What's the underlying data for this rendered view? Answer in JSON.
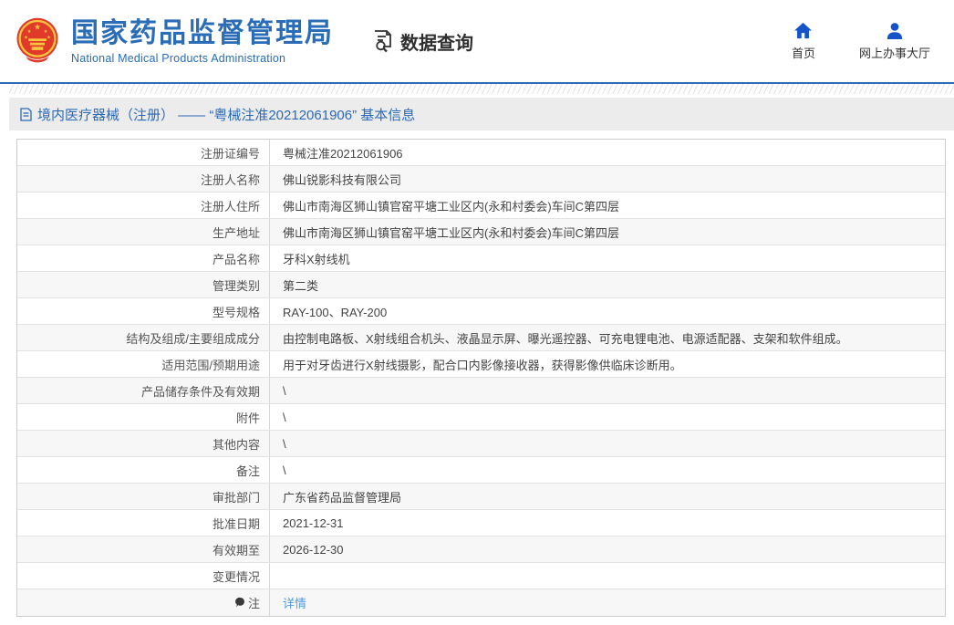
{
  "header": {
    "org_name_cn": "国家药品监督管理局",
    "org_name_en": "National Medical Products Administration",
    "section_label": "数据查询",
    "nav": [
      {
        "icon": "home-icon",
        "label": "首页"
      },
      {
        "icon": "user-icon",
        "label": "网上办事大厅"
      }
    ]
  },
  "breadcrumb": {
    "text": "境内医疗器械（注册） —— “粤械注准20212061906” 基本信息"
  },
  "table": {
    "rows": [
      {
        "label": "注册证编号",
        "value": "粤械注准20212061906"
      },
      {
        "label": "注册人名称",
        "value": "佛山锐影科技有限公司"
      },
      {
        "label": "注册人住所",
        "value": "佛山市南海区狮山镇官窑平塘工业区内(永和村委会)车间C第四层"
      },
      {
        "label": "生产地址",
        "value": "佛山市南海区狮山镇官窑平塘工业区内(永和村委会)车间C第四层"
      },
      {
        "label": "产品名称",
        "value": "牙科X射线机"
      },
      {
        "label": "管理类别",
        "value": "第二类"
      },
      {
        "label": "型号规格",
        "value": "RAY-100、RAY-200"
      },
      {
        "label": "结构及组成/主要组成成分",
        "value": "由控制电路板、X射线组合机头、液晶显示屏、曝光遥控器、可充电锂电池、电源适配器、支架和软件组成。"
      },
      {
        "label": "适用范围/预期用途",
        "value": "用于对牙齿进行X射线摄影，配合口内影像接收器，获得影像供临床诊断用。"
      },
      {
        "label": "产品储存条件及有效期",
        "value": "\\"
      },
      {
        "label": "附件",
        "value": "\\"
      },
      {
        "label": "其他内容",
        "value": "\\"
      },
      {
        "label": "备注",
        "value": "\\"
      },
      {
        "label": "审批部门",
        "value": "广东省药品监督管理局"
      },
      {
        "label": "批准日期",
        "value": "2021-12-31"
      },
      {
        "label": "有效期至",
        "value": "2026-12-30"
      },
      {
        "label": "变更情况",
        "value": ""
      },
      {
        "label": "注",
        "value": "详情",
        "label_icon": "note-bulb-icon",
        "is_link": true
      }
    ]
  },
  "colors": {
    "brand_blue": "#2a6cb6",
    "nav_icon_blue": "#1553c8",
    "divider_blue": "#2b6cb5",
    "breadcrumb_bg": "#ececec",
    "row_alt_bg": "#f7f7f7",
    "link_blue": "#4f9be5"
  }
}
